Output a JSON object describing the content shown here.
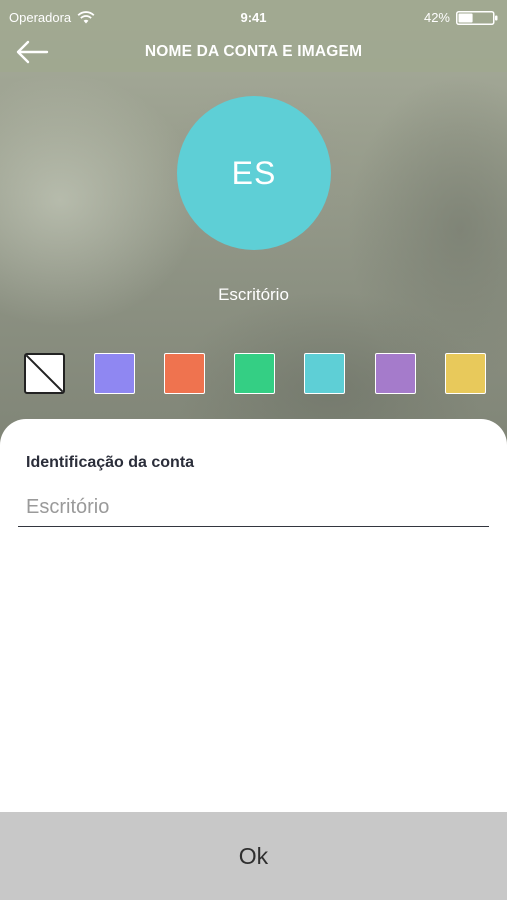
{
  "status_bar": {
    "carrier": "Operadora",
    "time": "9:41",
    "battery": "42%",
    "battery_level": 0.42
  },
  "header": {
    "title": "NOME DA CONTA E IMAGEM",
    "back_icon": "arrow-left-icon"
  },
  "avatar": {
    "initials": "ES",
    "color": "#5ecfd6"
  },
  "account_name": "Escritório",
  "swatches": [
    {
      "name": "none",
      "color": "#ffffff",
      "selected": true
    },
    {
      "name": "blue",
      "color": "#8f87f2",
      "selected": false
    },
    {
      "name": "orange",
      "color": "#ef734f",
      "selected": false
    },
    {
      "name": "green",
      "color": "#34cf84",
      "selected": false
    },
    {
      "name": "cyan",
      "color": "#5ecfd6",
      "selected": false
    },
    {
      "name": "purple",
      "color": "#a57bcb",
      "selected": false
    },
    {
      "name": "yellow",
      "color": "#e8c95b",
      "selected": false
    }
  ],
  "form": {
    "label": "Identificação da conta",
    "placeholder": "Escritório",
    "value": ""
  },
  "ok_button": {
    "label": "Ok"
  }
}
